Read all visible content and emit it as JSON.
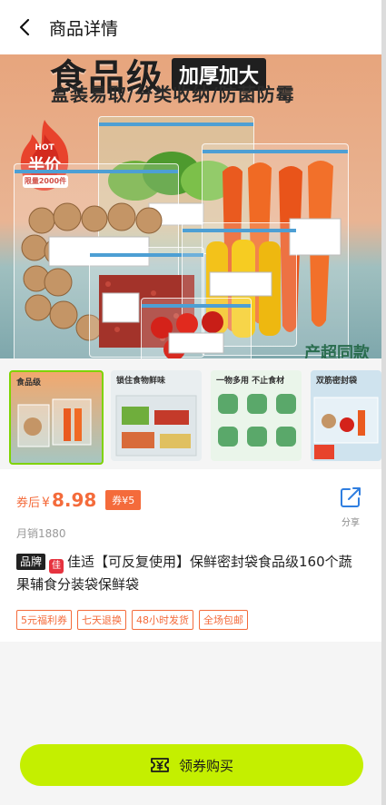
{
  "header": {
    "title": "商品详情"
  },
  "hero": {
    "banner_big": "食品级",
    "banner_thick": "加厚加大",
    "banner_sub": "盒装易取/分类收纳/防菌防霉",
    "hot_text": "HOT",
    "hot_half": "半价",
    "hot_limit": "限量2000件",
    "bottom_ribbon": "产超同款"
  },
  "thumbnails": [
    {
      "label": "食品级",
      "selected": true
    },
    {
      "label": "锁住食物鲜味",
      "selected": false
    },
    {
      "label": "一物多用 不止食材",
      "selected": false
    },
    {
      "label": "双筋密封袋",
      "selected": false
    }
  ],
  "product": {
    "price_prefix": "券后",
    "currency": "¥",
    "price": "8.98",
    "coupon": "券¥5",
    "share_label": "分享",
    "sales": "月销1880",
    "brand_badge": "品牌",
    "brand_logo": "佳",
    "title": "佳适【可反复使用】保鲜密封袋食品级160个蔬果辅食分装袋保鲜袋",
    "tags": [
      "5元福利券",
      "七天退换",
      "48小时发货",
      "全场包邮"
    ]
  },
  "buy_button": {
    "label": "领券购买",
    "icon": "coupon-yen-icon"
  },
  "colors": {
    "accent": "#f46b3b",
    "buy": "#c4ef00",
    "selected_thumb": "#7fd300"
  }
}
